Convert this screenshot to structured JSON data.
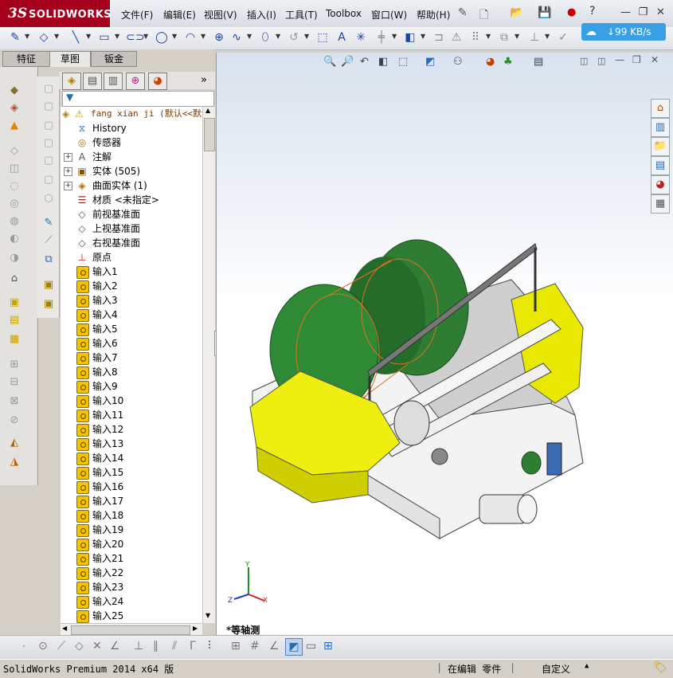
{
  "app": {
    "logo_prefix": "3S",
    "logo_name": "SOLIDWORKS"
  },
  "menu": [
    {
      "label": "文件(F)"
    },
    {
      "label": "编辑(E)"
    },
    {
      "label": "视图(V)"
    },
    {
      "label": "插入(I)"
    },
    {
      "label": "工具(T)"
    },
    {
      "label": "Toolbox"
    },
    {
      "label": "窗口(W)"
    },
    {
      "label": "帮助(H)"
    }
  ],
  "network_speed": "↓99 KB/s",
  "command_tabs": [
    {
      "label": "特征",
      "active": false
    },
    {
      "label": "草图",
      "active": true
    },
    {
      "label": "钣金",
      "active": false
    }
  ],
  "tree": {
    "root": "fang xian ji  (默认<<默认",
    "items": [
      {
        "label": "History",
        "icon": "history-icon",
        "expand": false
      },
      {
        "label": "传感器",
        "icon": "sensor-icon",
        "expand": false
      },
      {
        "label": "注解",
        "icon": "annotation-icon",
        "expand": true
      },
      {
        "label": "实体 (505)",
        "icon": "solid-body-icon",
        "expand": true
      },
      {
        "label": "曲面实体 (1)",
        "icon": "surface-body-icon",
        "expand": true
      },
      {
        "label": "材质 <未指定>",
        "icon": "material-icon",
        "expand": false
      },
      {
        "label": "前视基准面",
        "icon": "plane-icon",
        "expand": false
      },
      {
        "label": "上视基准面",
        "icon": "plane-icon",
        "expand": false
      },
      {
        "label": "右视基准面",
        "icon": "plane-icon",
        "expand": false
      },
      {
        "label": "原点",
        "icon": "origin-icon",
        "expand": false
      }
    ],
    "imports": [
      "输入1",
      "输入2",
      "输入3",
      "输入4",
      "输入5",
      "输入6",
      "输入7",
      "输入8",
      "输入9",
      "输入10",
      "输入11",
      "输入12",
      "输入13",
      "输入14",
      "输入15",
      "输入16",
      "输入17",
      "输入18",
      "输入19",
      "输入20",
      "输入21",
      "输入22",
      "输入23",
      "输入24",
      "输入25"
    ]
  },
  "view": {
    "orientation_label": "*等轴测",
    "triad": {
      "x": "X",
      "y": "Y",
      "z": "Z"
    }
  },
  "status": {
    "product": "SolidWorks Premium 2014 x64 版",
    "mode": "在编辑 零件",
    "units": "自定义"
  },
  "colors": {
    "brand": "#a5001c",
    "drum_green": "#2e7d32",
    "guard_yellow": "#f0f000",
    "speed_badge": "#3aa0e6"
  }
}
